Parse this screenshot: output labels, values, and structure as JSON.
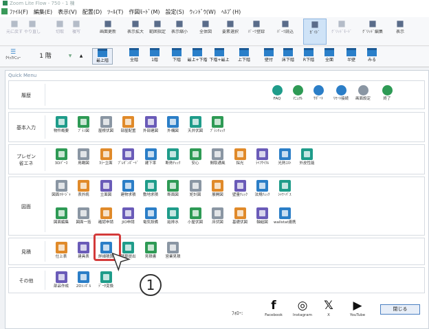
{
  "app": {
    "title": "Zoom Lite Flow - 750 - 1 棟",
    "close_label": "閉じる",
    "follow_label": "ﾌｫﾛｰ:"
  },
  "menu": [
    "ﾌｧｲﾙ(F)",
    "編集(E)",
    "表示(V)",
    "配置(D)",
    "ﾂｰﾙ(T)",
    "作図ﾓｰﾄﾞ(M)",
    "設定(S)",
    "ｳｨﾝﾄﾞｳ(W)",
    "ﾍﾙﾌﾟ(H)"
  ],
  "toolbar": [
    {
      "label": "元に戻す",
      "icon": "undo-icon",
      "dim": true
    },
    {
      "label": "やり直し",
      "icon": "redo-icon",
      "dim": true
    },
    {
      "label": "切取",
      "icon": "cut-icon",
      "dim": true
    },
    {
      "label": "複写",
      "icon": "copy-icon",
      "dim": true
    },
    {
      "label": "画面更新",
      "icon": "refresh-icon"
    },
    {
      "label": "表示拡大",
      "icon": "zoom-in-icon"
    },
    {
      "label": "範囲指定",
      "icon": "zoom-area-icon"
    },
    {
      "label": "表示縮小",
      "icon": "zoom-out-icon"
    },
    {
      "label": "全体図",
      "icon": "fit-icon"
    },
    {
      "label": "要素選択",
      "icon": "select-icon"
    },
    {
      "label": "ﾊﾟｰﾂ登録",
      "icon": "parts-reg-icon"
    },
    {
      "label": "ﾊﾟｰﾂ読込",
      "icon": "parts-load-icon"
    },
    {
      "label": "ｶﾞｲﾄﾞ",
      "icon": "guide-icon",
      "active": true
    },
    {
      "label": "ｸﾞﾘｯﾄﾞﾓｰﾄﾞ",
      "icon": "grid-icon",
      "dim": true
    },
    {
      "label": "ｸﾞﾘｯﾄﾞ編集",
      "icon": "grid-edit-icon"
    },
    {
      "label": "表示",
      "icon": "view-icon"
    }
  ],
  "floor": {
    "sidebar_label": "ｸｲｯｸﾒﾆｭｰ",
    "floor_label": "1 階",
    "arrow_down": "▼",
    "arrow_up": "▲",
    "items": [
      "最上階",
      "全階",
      "1階",
      "下階",
      "最上+下階",
      "下階+最上",
      "上下階",
      "壁付",
      "床下階",
      "R下階",
      "全面",
      "半壁",
      "みる"
    ]
  },
  "quickmenu": {
    "title": "Quick Menu",
    "sections": [
      {
        "label": "履歴",
        "buttons": []
      },
      {
        "label": "基本入力",
        "buttons": [
          "物件概要",
          "ﾌﾟﾗﾝ図",
          "屋根伏図",
          "部屋配置",
          "外部建図",
          "外構図",
          "天井伏図",
          "ﾌﾟﾗﾝﾁｪｯｸ"
        ]
      },
      {
        "label": "プレゼン",
        "sublabel": "省エネ",
        "buttons": [
          "3Dﾊﾟｰｽ",
          "鳥瞰図",
          "ｶﾗｰ立面",
          "ﾌﾟﾚｾﾞﾝﾎﾞｰﾄﾞ",
          "建下率",
          "断熱ﾁｪｯｸ",
          "安心",
          "間取通風",
          "採光",
          "ﾗｲﾌｻｲｸﾙ",
          "光熱ｺｽﾄ",
          "外皮性能"
        ]
      },
      {
        "label": "図面",
        "buttons": [
          "図面ﾏﾈｰｼﾞｬ",
          "表外統",
          "立面図",
          "建物求積",
          "敷地求積",
          "断面図",
          "矩計図",
          "展開図",
          "壁量ﾁｪｯｸ",
          "法規ﾁｪｯｸ",
          "ｼｬﾜｰﾊﾟｽ",
          "図面編集",
          "図面一括",
          "確認申請",
          "JIO申請",
          "電気設備",
          "給排水",
          "小屋伏図",
          "床伏図",
          "基礎伏図",
          "軸組図",
          "wallstat連携"
        ]
      },
      {
        "label": "見積",
        "buttons": [
          "仕上表",
          "建具表",
          "詳細積算",
          "積算提出",
          "見積書",
          "営業見積"
        ]
      },
      {
        "label": "その他",
        "buttons": [
          "部品作成",
          "2Dｼﾝﾎﾞﾙ",
          "ﾃﾞｰﾀ変換"
        ]
      }
    ],
    "history_buttons": [
      "FAQ",
      "ﾏﾆｭｱﾙ",
      "ｻﾎﾟｰﾄ",
      "ﾘﾓｰﾄ接続",
      "画面設定",
      "終了"
    ]
  },
  "callout": "1",
  "social": [
    {
      "label": "Facebook",
      "icon": "facebook-icon",
      "glyph": "f"
    },
    {
      "label": "Instagram",
      "icon": "instagram-icon",
      "glyph": "◎"
    },
    {
      "label": "X",
      "icon": "x-icon",
      "glyph": "𝕏"
    },
    {
      "label": "YouTube",
      "icon": "youtube-icon",
      "glyph": "▶"
    }
  ],
  "colors": {
    "highlight": "#d33a3a",
    "accent": "#2b7ec7"
  }
}
